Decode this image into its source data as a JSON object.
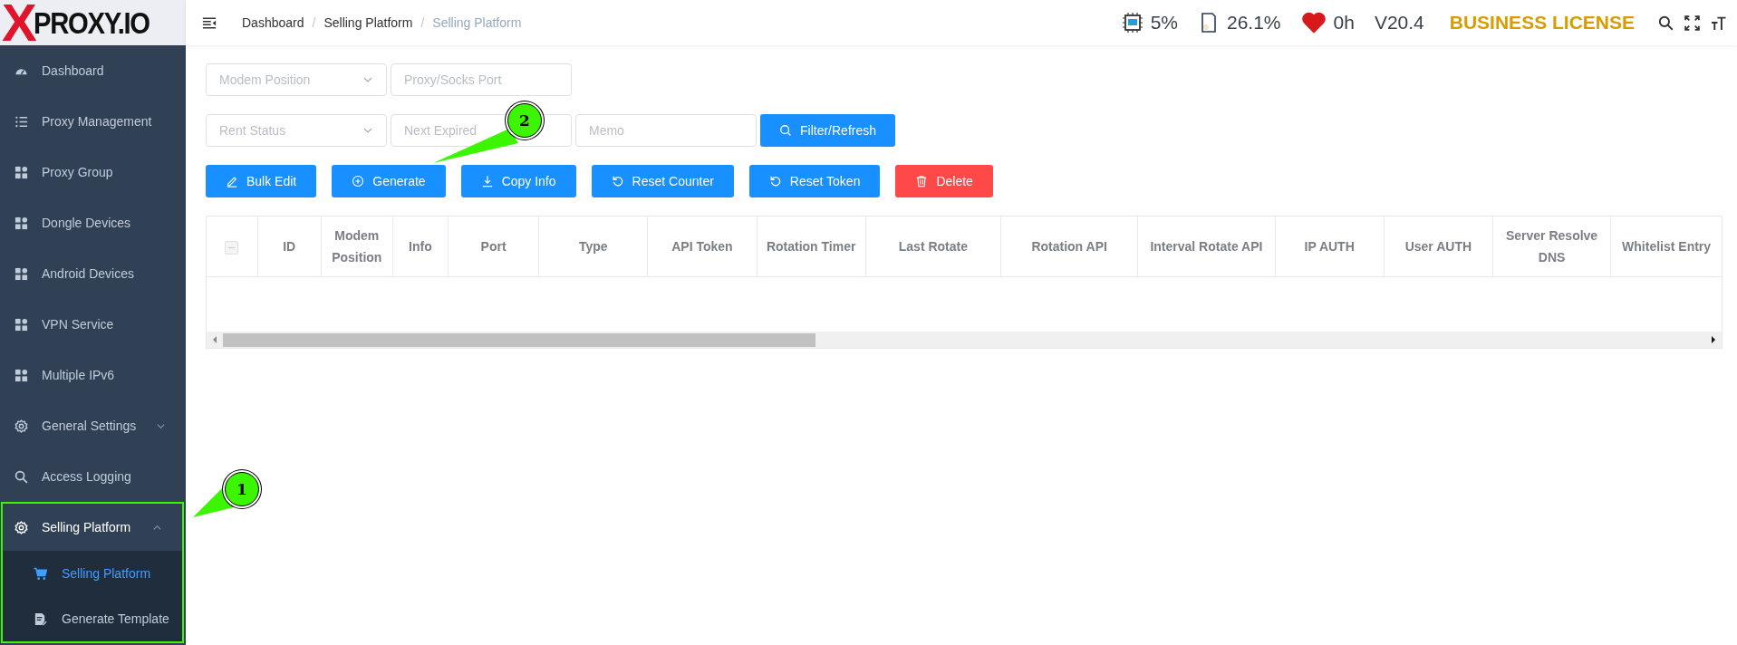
{
  "logo": {
    "mark": "X",
    "name": "PROXY.IO"
  },
  "sidebar": {
    "items": [
      {
        "label": "Dashboard"
      },
      {
        "label": "Proxy Management"
      },
      {
        "label": "Proxy Group"
      },
      {
        "label": "Dongle Devices"
      },
      {
        "label": "Android Devices"
      },
      {
        "label": "VPN Service"
      },
      {
        "label": "Multiple IPv6"
      },
      {
        "label": "General Settings",
        "expanded": false
      },
      {
        "label": "Access Logging"
      },
      {
        "label": "Selling Platform",
        "expanded": true,
        "highlighted": true,
        "children": [
          {
            "label": "Selling Platform",
            "selected": true
          },
          {
            "label": "Generate Template",
            "selected": false
          }
        ]
      }
    ]
  },
  "breadcrumbs": [
    {
      "label": "Dashboard",
      "current": false
    },
    {
      "separator": "/",
      "label": "Selling Platform",
      "current": false
    },
    {
      "separator": "/",
      "label": "Selling Platform",
      "current": true
    }
  ],
  "stats": {
    "cpu": "5%",
    "ram": "26.1%",
    "uptime": "0h",
    "version": "V20.4",
    "license": "BUSINESS LICENSE"
  },
  "filters": [
    [
      {
        "kind": "select",
        "placeholder": "Modem Position"
      },
      {
        "kind": "input",
        "placeholder": "Proxy/Socks Port"
      }
    ],
    [
      {
        "kind": "select",
        "placeholder": "Rent Status"
      },
      {
        "kind": "input",
        "placeholder": "Next Expired"
      },
      {
        "kind": "input",
        "placeholder": "Memo"
      },
      {
        "kind": "button",
        "label": "Filter/Refresh"
      }
    ]
  ],
  "actions": [
    {
      "label": "Bulk Edit",
      "kind": "primary"
    },
    {
      "label": "Generate",
      "kind": "primary"
    },
    {
      "label": "Copy Info",
      "kind": "primary"
    },
    {
      "label": "Reset Counter",
      "kind": "primary"
    },
    {
      "label": "Reset Token",
      "kind": "primary"
    },
    {
      "label": "Delete",
      "kind": "danger"
    }
  ],
  "table": {
    "select_all": {
      "indeterminate": true
    },
    "columns": [
      "ID",
      "Modem Position",
      "Info",
      "Port",
      "Type",
      "API Token",
      "Rotation Timer",
      "Last Rotate",
      "Rotation API",
      "Interval Rotate API",
      "IP AUTH",
      "User AUTH",
      "Server Resolve DNS",
      "Whitelist Entry"
    ]
  },
  "annotations": [
    {
      "label": "1"
    },
    {
      "label": "2"
    }
  ]
}
